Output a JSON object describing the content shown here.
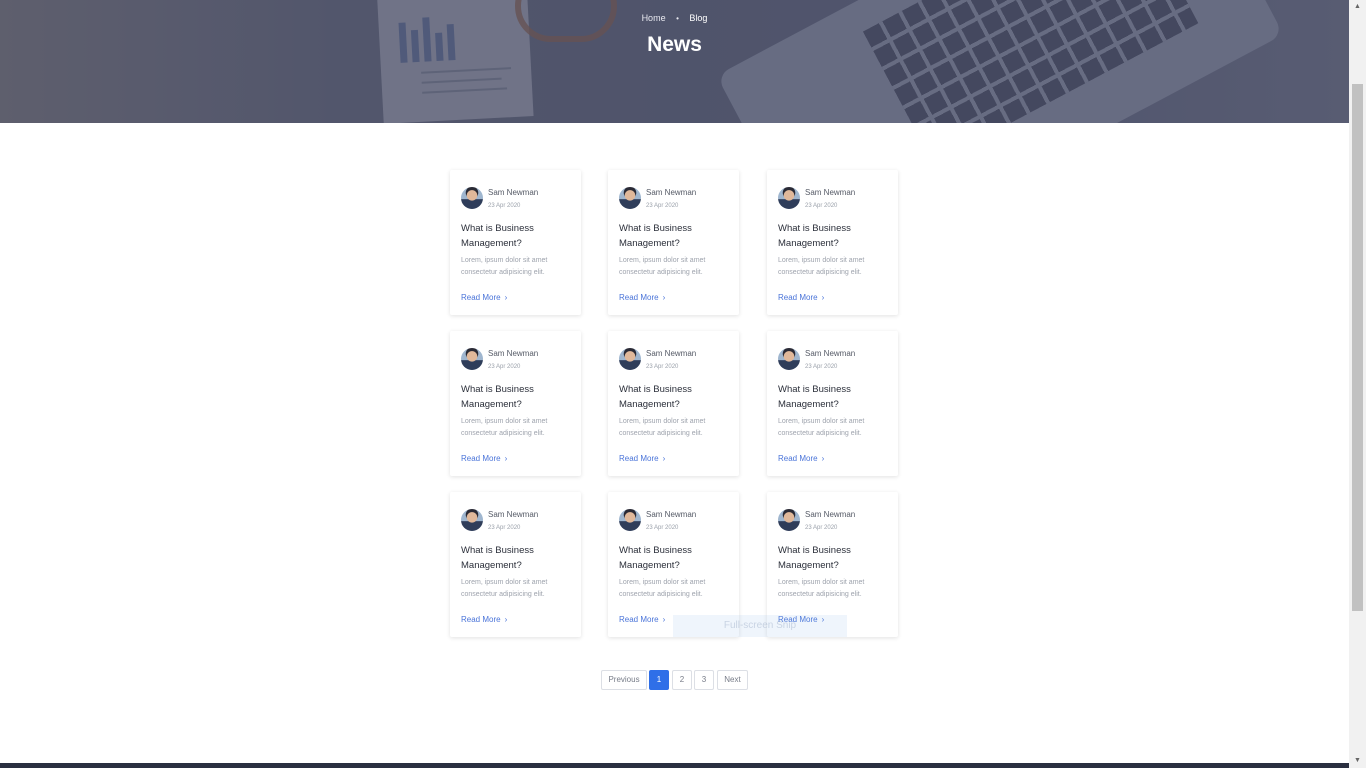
{
  "breadcrumb": {
    "home": "Home",
    "separator": "•",
    "current": "Blog"
  },
  "page_title": "News",
  "posts": [
    {
      "author": "Sam Newman",
      "date": "23 Apr 2020",
      "title": "What is Business Management?",
      "excerpt": "Lorem, ipsum dolor sit amet consectetur adipisicing elit.",
      "read_more": "Read More"
    },
    {
      "author": "Sam Newman",
      "date": "23 Apr 2020",
      "title": "What is Business Management?",
      "excerpt": "Lorem, ipsum dolor sit amet consectetur adipisicing elit.",
      "read_more": "Read More"
    },
    {
      "author": "Sam Newman",
      "date": "23 Apr 2020",
      "title": "What is Business Management?",
      "excerpt": "Lorem, ipsum dolor sit amet consectetur adipisicing elit.",
      "read_more": "Read More"
    },
    {
      "author": "Sam Newman",
      "date": "23 Apr 2020",
      "title": "What is Business Management?",
      "excerpt": "Lorem, ipsum dolor sit amet consectetur adipisicing elit.",
      "read_more": "Read More"
    },
    {
      "author": "Sam Newman",
      "date": "23 Apr 2020",
      "title": "What is Business Management?",
      "excerpt": "Lorem, ipsum dolor sit amet consectetur adipisicing elit.",
      "read_more": "Read More"
    },
    {
      "author": "Sam Newman",
      "date": "23 Apr 2020",
      "title": "What is Business Management?",
      "excerpt": "Lorem, ipsum dolor sit amet consectetur adipisicing elit.",
      "read_more": "Read More"
    },
    {
      "author": "Sam Newman",
      "date": "23 Apr 2020",
      "title": "What is Business Management?",
      "excerpt": "Lorem, ipsum dolor sit amet consectetur adipisicing elit.",
      "read_more": "Read More"
    },
    {
      "author": "Sam Newman",
      "date": "23 Apr 2020",
      "title": "What is Business Management?",
      "excerpt": "Lorem, ipsum dolor sit amet consectetur adipisicing elit.",
      "read_more": "Read More"
    },
    {
      "author": "Sam Newman",
      "date": "23 Apr 2020",
      "title": "What is Business Management?",
      "excerpt": "Lorem, ipsum dolor sit amet consectetur adipisicing elit.",
      "read_more": "Read More"
    }
  ],
  "pagination": {
    "previous": "Previous",
    "pages": [
      "1",
      "2",
      "3"
    ],
    "active_page": "1",
    "next": "Next"
  },
  "toast": "Full-screen Snip",
  "icons": {
    "read_more": "chevron-right-icon",
    "scroll_up": "arrow-up-icon",
    "scroll_down": "arrow-down-icon"
  },
  "colors": {
    "accent": "#2f6fe8",
    "link": "#4a74d9",
    "hero_overlay": "#404460",
    "footer": "#2a2f40"
  }
}
